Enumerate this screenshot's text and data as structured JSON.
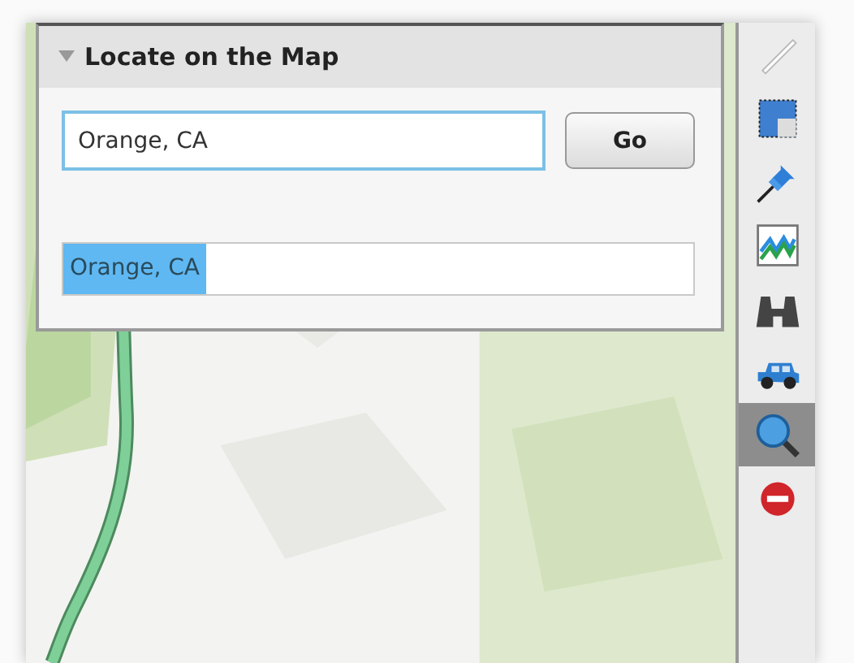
{
  "panel": {
    "title": "Locate on the Map",
    "expanded": true,
    "search": {
      "value": "Orange, CA"
    },
    "go_button": "Go",
    "results": [
      {
        "label": "Orange, CA",
        "selected": true
      }
    ]
  },
  "toolbar": [
    {
      "kind": "pencil",
      "selected": false
    },
    {
      "kind": "select",
      "selected": false
    },
    {
      "kind": "pin",
      "selected": false
    },
    {
      "kind": "chart",
      "selected": false
    },
    {
      "kind": "binoculars",
      "selected": false
    },
    {
      "kind": "car",
      "selected": false
    },
    {
      "kind": "magnifier",
      "selected": true
    },
    {
      "kind": "stop",
      "selected": false
    }
  ]
}
